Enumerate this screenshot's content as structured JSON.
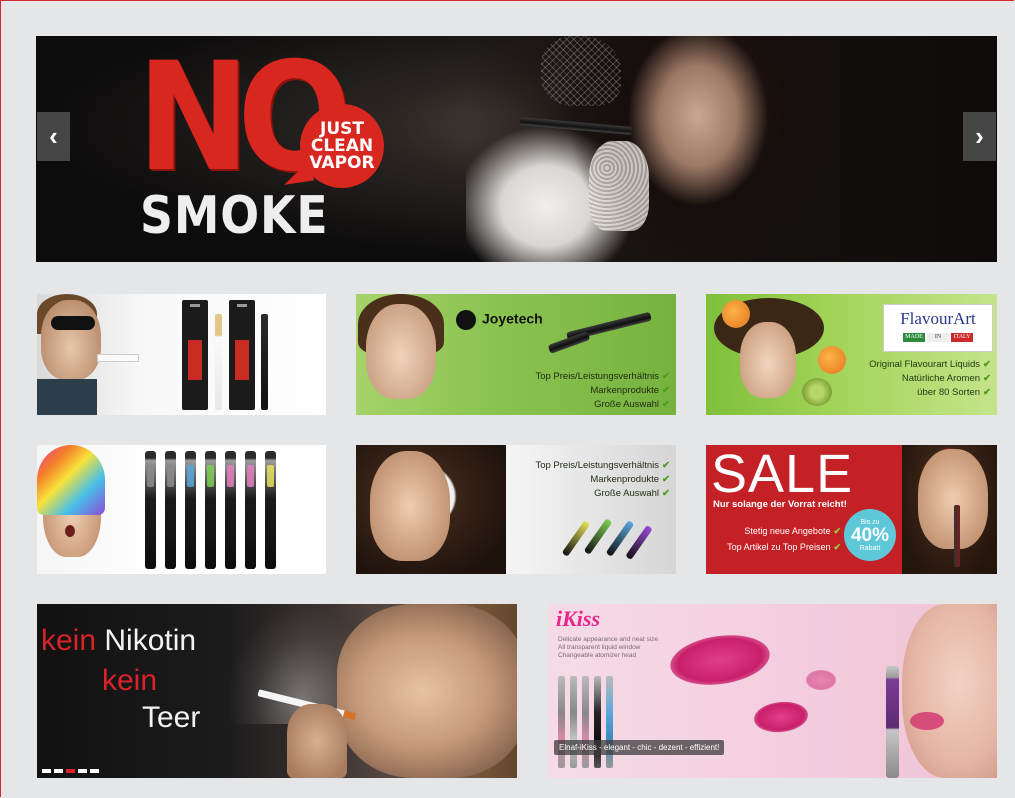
{
  "hero": {
    "headline_no": "NO",
    "bubble_lines": [
      "JUST",
      "CLEAN",
      "VAPOR"
    ],
    "headline_smoke": "SMOKE",
    "prev_symbol": "‹",
    "next_symbol": "›"
  },
  "tiles": {
    "joyetech": {
      "brand": "Joyetech",
      "features": [
        "Top Preis/Leistungsverhältnis",
        "Markenprodukte",
        "Große Auswahl"
      ]
    },
    "flavourart": {
      "brand": "FlavourArt",
      "flags": [
        "MADE",
        "IN",
        "ITALY"
      ],
      "features": [
        "Original Flavourart Liquids",
        "Natürliche Aromen",
        "über 80 Sorten"
      ]
    },
    "clearomizer": {
      "features": [
        "Top Preis/Leistungsverhältnis",
        "Markenprodukte",
        "Große Auswahl"
      ]
    },
    "sale": {
      "title": "SALE",
      "subtitle": "Nur solange der Vorrat reicht!",
      "features": [
        "Stetig neue Angebote",
        "Top Artikel zu Top Preisen"
      ],
      "badge": {
        "top": "Bis zu",
        "value": "40%",
        "bottom": "Rabatt"
      }
    }
  },
  "check_symbol": "✔",
  "banners": {
    "nikotin": {
      "kein1": "kein",
      "nikotin": "Nikotin",
      "kein2": "kein",
      "teer": "Teer"
    },
    "ikiss": {
      "brand": "iKiss",
      "tagline": [
        "Delicate appearance and neat size",
        "All transparent liquid window",
        "Changeable atomizer head"
      ],
      "caption": "Elnaf-iKiss - elegant - chic - dezent - effizient!"
    }
  },
  "colors": {
    "accent_red": "#d8232a",
    "sale_red": "#c42126",
    "check_green": "#4f9b1e",
    "ikiss_pink": "#e8268a"
  }
}
